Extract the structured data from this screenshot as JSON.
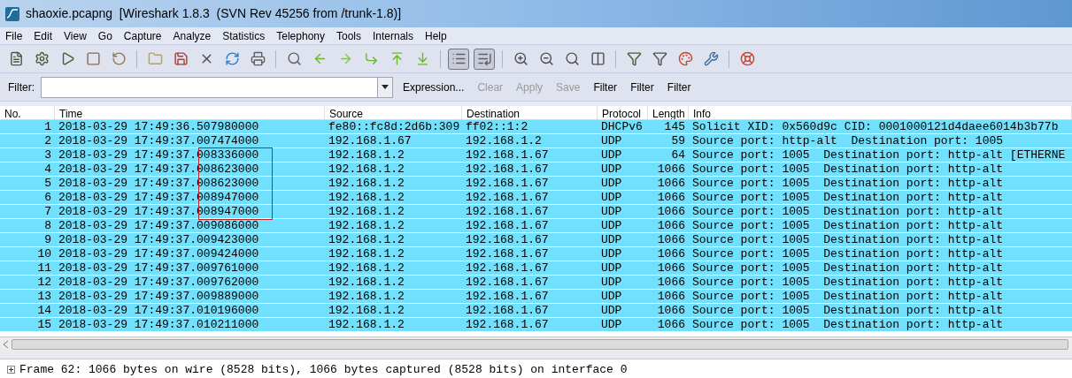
{
  "window": {
    "title": "shaoxie.pcapng  [Wireshark 1.8.3  (SVN Rev 45256 from /trunk-1.8)]"
  },
  "menu": [
    "File",
    "Edit",
    "View",
    "Go",
    "Capture",
    "Analyze",
    "Statistics",
    "Telephony",
    "Tools",
    "Internals",
    "Help"
  ],
  "toolbar": [
    {
      "kind": "interface-list",
      "pressed": false
    },
    {
      "kind": "options",
      "pressed": false
    },
    {
      "kind": "start",
      "pressed": false
    },
    {
      "kind": "stop",
      "pressed": false
    },
    {
      "kind": "restart",
      "pressed": false
    },
    {
      "kind": "sep"
    },
    {
      "kind": "open",
      "pressed": false
    },
    {
      "kind": "save",
      "pressed": false
    },
    {
      "kind": "close",
      "pressed": false
    },
    {
      "kind": "reload",
      "pressed": false
    },
    {
      "kind": "print",
      "pressed": false
    },
    {
      "kind": "sep"
    },
    {
      "kind": "find",
      "pressed": false
    },
    {
      "kind": "back",
      "pressed": false
    },
    {
      "kind": "forward",
      "pressed": false
    },
    {
      "kind": "goto",
      "pressed": false
    },
    {
      "kind": "first",
      "pressed": false
    },
    {
      "kind": "last",
      "pressed": false
    },
    {
      "kind": "sep"
    },
    {
      "kind": "colorize",
      "pressed": true
    },
    {
      "kind": "autoscroll",
      "pressed": true
    },
    {
      "kind": "sep"
    },
    {
      "kind": "zoom-in",
      "pressed": false
    },
    {
      "kind": "zoom-out",
      "pressed": false
    },
    {
      "kind": "zoom-reset",
      "pressed": false
    },
    {
      "kind": "resize",
      "pressed": false
    },
    {
      "kind": "sep"
    },
    {
      "kind": "capture-filter",
      "pressed": false
    },
    {
      "kind": "display-filter",
      "pressed": false
    },
    {
      "kind": "coloring",
      "pressed": false
    },
    {
      "kind": "prefs",
      "pressed": false
    },
    {
      "kind": "sep"
    },
    {
      "kind": "help",
      "pressed": false
    }
  ],
  "filter_bar": {
    "label": "Filter:",
    "buttons": [
      {
        "label": "Expression...",
        "disabled": false
      },
      {
        "label": "Clear",
        "disabled": true
      },
      {
        "label": "Apply",
        "disabled": true
      },
      {
        "label": "Save",
        "disabled": true
      },
      {
        "label": "Filter",
        "disabled": false
      },
      {
        "label": "Filter",
        "disabled": false
      },
      {
        "label": "Filter",
        "disabled": false
      }
    ]
  },
  "table": {
    "columns": [
      "No.",
      "Time",
      "Source",
      "Destination",
      "Protocol",
      "Length",
      "Info"
    ],
    "rows": [
      {
        "no": "1",
        "time": "2018-03-29 17:49:36.507980000",
        "source": "fe80::fc8d:2d6b:309",
        "destination": "ff02::1:2",
        "protocol": "DHCPv6",
        "length": "145",
        "info": "Solicit XID: 0x560d9c CID: 0001000121d4daee6014b3b77b",
        "boxed": false
      },
      {
        "no": "2",
        "time": "2018-03-29 17:49:37.007474000",
        "source": "192.168.1.67",
        "destination": "192.168.1.2",
        "protocol": "UDP",
        "length": "59",
        "info": "Source port: http-alt  Destination port: 1005",
        "boxed": false
      },
      {
        "no": "3",
        "time": "2018-03-29 17:49:37.008336000",
        "source": "192.168.1.2",
        "destination": "192.168.1.67",
        "protocol": "UDP",
        "length": "64",
        "info": "Source port: 1005  Destination port: http-alt [ETHERNE",
        "boxed": true
      },
      {
        "no": "4",
        "time": "2018-03-29 17:49:37.008623000",
        "source": "192.168.1.2",
        "destination": "192.168.1.67",
        "protocol": "UDP",
        "length": "1066",
        "info": "Source port: 1005  Destination port: http-alt",
        "boxed": true
      },
      {
        "no": "5",
        "time": "2018-03-29 17:49:37.008623000",
        "source": "192.168.1.2",
        "destination": "192.168.1.67",
        "protocol": "UDP",
        "length": "1066",
        "info": "Source port: 1005  Destination port: http-alt",
        "boxed": true
      },
      {
        "no": "6",
        "time": "2018-03-29 17:49:37.008947000",
        "source": "192.168.1.2",
        "destination": "192.168.1.67",
        "protocol": "UDP",
        "length": "1066",
        "info": "Source port: 1005  Destination port: http-alt",
        "boxed": true
      },
      {
        "no": "7",
        "time": "2018-03-29 17:49:37.008947000",
        "source": "192.168.1.2",
        "destination": "192.168.1.67",
        "protocol": "UDP",
        "length": "1066",
        "info": "Source port: 1005  Destination port: http-alt",
        "boxed": true
      },
      {
        "no": "8",
        "time": "2018-03-29 17:49:37.009086000",
        "source": "192.168.1.2",
        "destination": "192.168.1.67",
        "protocol": "UDP",
        "length": "1066",
        "info": "Source port: 1005  Destination port: http-alt",
        "boxed": false
      },
      {
        "no": "9",
        "time": "2018-03-29 17:49:37.009423000",
        "source": "192.168.1.2",
        "destination": "192.168.1.67",
        "protocol": "UDP",
        "length": "1066",
        "info": "Source port: 1005  Destination port: http-alt",
        "boxed": false
      },
      {
        "no": "10",
        "time": "2018-03-29 17:49:37.009424000",
        "source": "192.168.1.2",
        "destination": "192.168.1.67",
        "protocol": "UDP",
        "length": "1066",
        "info": "Source port: 1005  Destination port: http-alt",
        "boxed": false
      },
      {
        "no": "11",
        "time": "2018-03-29 17:49:37.009761000",
        "source": "192.168.1.2",
        "destination": "192.168.1.67",
        "protocol": "UDP",
        "length": "1066",
        "info": "Source port: 1005  Destination port: http-alt",
        "boxed": false
      },
      {
        "no": "12",
        "time": "2018-03-29 17:49:37.009762000",
        "source": "192.168.1.2",
        "destination": "192.168.1.67",
        "protocol": "UDP",
        "length": "1066",
        "info": "Source port: 1005  Destination port: http-alt",
        "boxed": false
      },
      {
        "no": "13",
        "time": "2018-03-29 17:49:37.009889000",
        "source": "192.168.1.2",
        "destination": "192.168.1.67",
        "protocol": "UDP",
        "length": "1066",
        "info": "Source port: 1005  Destination port: http-alt",
        "boxed": false
      },
      {
        "no": "14",
        "time": "2018-03-29 17:49:37.010196000",
        "source": "192.168.1.2",
        "destination": "192.168.1.67",
        "protocol": "UDP",
        "length": "1066",
        "info": "Source port: 1005  Destination port: http-alt",
        "boxed": false
      },
      {
        "no": "15",
        "time": "2018-03-29 17:49:37.010211000",
        "source": "192.168.1.2",
        "destination": "192.168.1.67",
        "protocol": "UDP",
        "length": "1066",
        "info": "Source port: 1005  Destination port: http-alt",
        "boxed": false
      }
    ]
  },
  "details": [
    {
      "text": "Frame 62: 1066 bytes on wire (8528 bits), 1066 bytes captured (8528 bits) on interface 0",
      "expanded": false
    }
  ]
}
